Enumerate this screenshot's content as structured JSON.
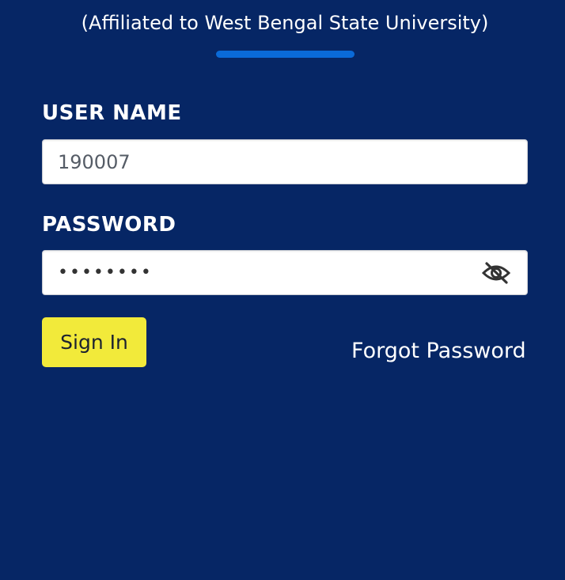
{
  "header": {
    "affiliation_text": "(Affiliated to West Bengal State University)"
  },
  "login_form": {
    "username_label": "USER NAME",
    "username_value": "190007",
    "password_label": "PASSWORD",
    "password_value": "12345678",
    "password_visibility_icon": "eye-off-icon",
    "signin_label": "Sign In",
    "forgot_password_label": "Forgot Password"
  },
  "colors": {
    "background": "#062665",
    "accent_bar": "#0a6ad8",
    "signin_button": "#f2ea3a",
    "text_on_dark": "#ffffff"
  }
}
